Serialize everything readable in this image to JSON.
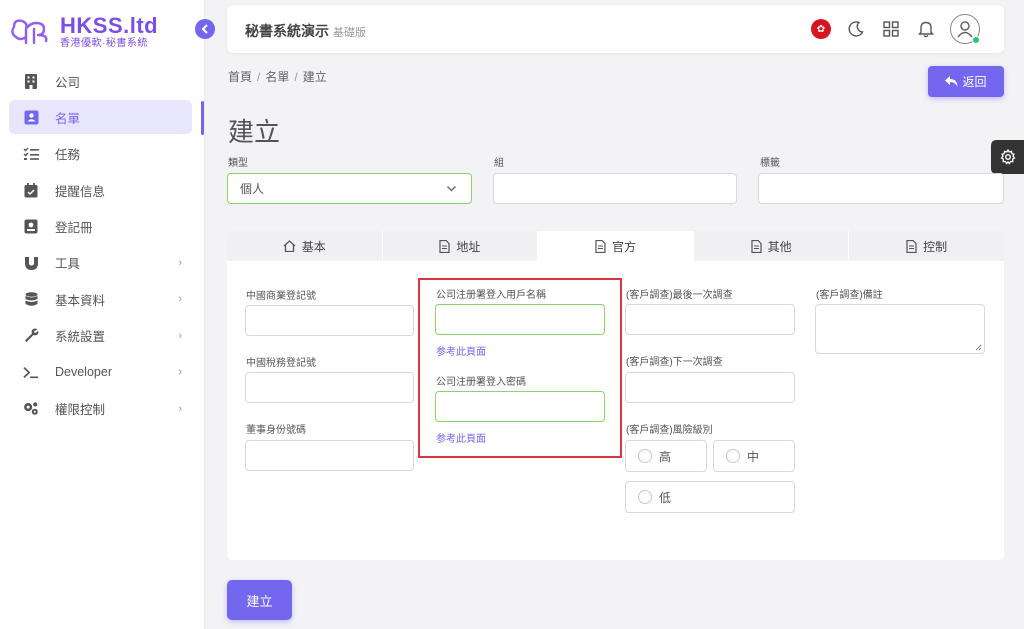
{
  "brand": {
    "name": "HKSS.ltd",
    "subtitle": "香港優軟·秘書系統"
  },
  "sidebar": {
    "items": [
      {
        "label": "公司",
        "icon": "building-icon",
        "chevron": false
      },
      {
        "label": "名單",
        "icon": "contact-card-icon",
        "chevron": false,
        "active": true
      },
      {
        "label": "任務",
        "icon": "checklist-icon",
        "chevron": false
      },
      {
        "label": "提醒信息",
        "icon": "calendar-check-icon",
        "chevron": false
      },
      {
        "label": "登記冊",
        "icon": "register-book-icon",
        "chevron": false
      },
      {
        "label": "工具",
        "icon": "magnet-icon",
        "chevron": true
      },
      {
        "label": "基本資料",
        "icon": "database-icon",
        "chevron": true
      },
      {
        "label": "系統設置",
        "icon": "wrench-icon",
        "chevron": true
      },
      {
        "label": "Developer",
        "icon": "terminal-icon",
        "chevron": true
      },
      {
        "label": "權限控制",
        "icon": "cogs-icon",
        "chevron": true
      }
    ]
  },
  "header": {
    "title": "秘書系統演示",
    "subtitle": "基礎版"
  },
  "breadcrumb": {
    "home": "首頁",
    "list": "名單",
    "current": "建立",
    "sep": "/"
  },
  "back_button": "返回",
  "page_title": "建立",
  "top_form": {
    "type_label": "類型",
    "type_value": "個人",
    "group_label": "組",
    "group_value": "",
    "tags_label": "標籤",
    "tags_value": ""
  },
  "tabs": [
    {
      "label": "基本",
      "icon": "home-icon",
      "active": false
    },
    {
      "label": "地址",
      "icon": "document-icon",
      "active": false
    },
    {
      "label": "官方",
      "icon": "document-icon",
      "active": true
    },
    {
      "label": "其他",
      "icon": "document-icon",
      "active": false
    },
    {
      "label": "控制",
      "icon": "document-icon",
      "active": false
    }
  ],
  "official": {
    "col1": {
      "biz_reg_label": "中國商業登記號",
      "tax_reg_label": "中國稅務登記號",
      "director_id_label": "董事身份號碼"
    },
    "col2": {
      "login_user_label": "公司注册署登入用戶名稱",
      "login_user_link": "参考此頁面",
      "login_pass_label": "公司注册署登入密碼",
      "login_pass_link": "参考此頁面"
    },
    "col3": {
      "last_review_label": "(客戶調查)最後一次調查",
      "next_review_label": "(客戶調查)下一次調查",
      "risk_label": "(客戶調查)風險級別",
      "risk_options": [
        "高",
        "中",
        "低"
      ]
    },
    "col4": {
      "remarks_label": "(客戶調查)備註"
    }
  },
  "create_button": "建立",
  "colors": {
    "accent": "#7367f0",
    "highlight": "#d9363e",
    "focus_green": "#8bd36a"
  }
}
